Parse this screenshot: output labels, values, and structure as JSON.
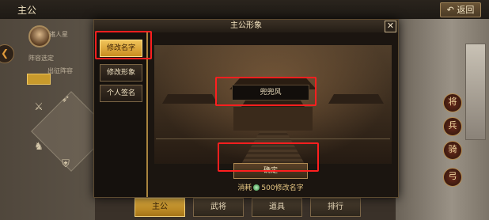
{
  "background": {
    "screen_title": "主公",
    "back_label": "返回",
    "left_texts": [
      "诸人星",
      "阵容选定",
      "出征阵容"
    ],
    "bottom_tabs": [
      {
        "label": "主公",
        "active": true
      },
      {
        "label": "武将",
        "active": false
      },
      {
        "label": "道具",
        "active": false
      },
      {
        "label": "排行",
        "active": false
      }
    ]
  },
  "dialog": {
    "title": "主公形象",
    "side_tabs": [
      {
        "label": "修改名字",
        "active": true
      },
      {
        "label": "修改形象",
        "active": false
      },
      {
        "label": "个人签名",
        "active": false
      }
    ],
    "name_value": "兜兜风",
    "confirm_label": "确定",
    "cost": {
      "prefix": "消耗",
      "amount": "500",
      "suffix": "修改名字"
    }
  },
  "colors": {
    "highlight": "#ff1f1f",
    "active_tab": "#f0c45a",
    "gold_text": "#e8c884"
  },
  "icons": [
    "close-icon",
    "gem-icon",
    "back-arrow-icon",
    "avatar"
  ]
}
